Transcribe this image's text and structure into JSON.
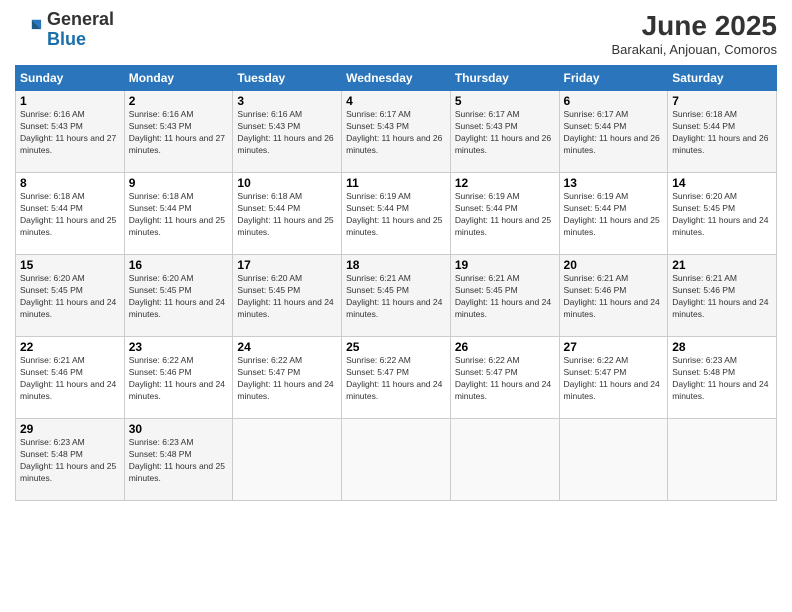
{
  "header": {
    "logo_general": "General",
    "logo_blue": "Blue",
    "title": "June 2025",
    "subtitle": "Barakani, Anjouan, Comoros"
  },
  "days_of_week": [
    "Sunday",
    "Monday",
    "Tuesday",
    "Wednesday",
    "Thursday",
    "Friday",
    "Saturday"
  ],
  "weeks": [
    [
      {
        "day": "1",
        "sunrise": "6:16 AM",
        "sunset": "5:43 PM",
        "daylight": "11 hours and 27 minutes."
      },
      {
        "day": "2",
        "sunrise": "6:16 AM",
        "sunset": "5:43 PM",
        "daylight": "11 hours and 27 minutes."
      },
      {
        "day": "3",
        "sunrise": "6:16 AM",
        "sunset": "5:43 PM",
        "daylight": "11 hours and 26 minutes."
      },
      {
        "day": "4",
        "sunrise": "6:17 AM",
        "sunset": "5:43 PM",
        "daylight": "11 hours and 26 minutes."
      },
      {
        "day": "5",
        "sunrise": "6:17 AM",
        "sunset": "5:43 PM",
        "daylight": "11 hours and 26 minutes."
      },
      {
        "day": "6",
        "sunrise": "6:17 AM",
        "sunset": "5:44 PM",
        "daylight": "11 hours and 26 minutes."
      },
      {
        "day": "7",
        "sunrise": "6:18 AM",
        "sunset": "5:44 PM",
        "daylight": "11 hours and 26 minutes."
      }
    ],
    [
      {
        "day": "8",
        "sunrise": "6:18 AM",
        "sunset": "5:44 PM",
        "daylight": "11 hours and 25 minutes."
      },
      {
        "day": "9",
        "sunrise": "6:18 AM",
        "sunset": "5:44 PM",
        "daylight": "11 hours and 25 minutes."
      },
      {
        "day": "10",
        "sunrise": "6:18 AM",
        "sunset": "5:44 PM",
        "daylight": "11 hours and 25 minutes."
      },
      {
        "day": "11",
        "sunrise": "6:19 AM",
        "sunset": "5:44 PM",
        "daylight": "11 hours and 25 minutes."
      },
      {
        "day": "12",
        "sunrise": "6:19 AM",
        "sunset": "5:44 PM",
        "daylight": "11 hours and 25 minutes."
      },
      {
        "day": "13",
        "sunrise": "6:19 AM",
        "sunset": "5:44 PM",
        "daylight": "11 hours and 25 minutes."
      },
      {
        "day": "14",
        "sunrise": "6:20 AM",
        "sunset": "5:45 PM",
        "daylight": "11 hours and 24 minutes."
      }
    ],
    [
      {
        "day": "15",
        "sunrise": "6:20 AM",
        "sunset": "5:45 PM",
        "daylight": "11 hours and 24 minutes."
      },
      {
        "day": "16",
        "sunrise": "6:20 AM",
        "sunset": "5:45 PM",
        "daylight": "11 hours and 24 minutes."
      },
      {
        "day": "17",
        "sunrise": "6:20 AM",
        "sunset": "5:45 PM",
        "daylight": "11 hours and 24 minutes."
      },
      {
        "day": "18",
        "sunrise": "6:21 AM",
        "sunset": "5:45 PM",
        "daylight": "11 hours and 24 minutes."
      },
      {
        "day": "19",
        "sunrise": "6:21 AM",
        "sunset": "5:45 PM",
        "daylight": "11 hours and 24 minutes."
      },
      {
        "day": "20",
        "sunrise": "6:21 AM",
        "sunset": "5:46 PM",
        "daylight": "11 hours and 24 minutes."
      },
      {
        "day": "21",
        "sunrise": "6:21 AM",
        "sunset": "5:46 PM",
        "daylight": "11 hours and 24 minutes."
      }
    ],
    [
      {
        "day": "22",
        "sunrise": "6:21 AM",
        "sunset": "5:46 PM",
        "daylight": "11 hours and 24 minutes."
      },
      {
        "day": "23",
        "sunrise": "6:22 AM",
        "sunset": "5:46 PM",
        "daylight": "11 hours and 24 minutes."
      },
      {
        "day": "24",
        "sunrise": "6:22 AM",
        "sunset": "5:47 PM",
        "daylight": "11 hours and 24 minutes."
      },
      {
        "day": "25",
        "sunrise": "6:22 AM",
        "sunset": "5:47 PM",
        "daylight": "11 hours and 24 minutes."
      },
      {
        "day": "26",
        "sunrise": "6:22 AM",
        "sunset": "5:47 PM",
        "daylight": "11 hours and 24 minutes."
      },
      {
        "day": "27",
        "sunrise": "6:22 AM",
        "sunset": "5:47 PM",
        "daylight": "11 hours and 24 minutes."
      },
      {
        "day": "28",
        "sunrise": "6:23 AM",
        "sunset": "5:48 PM",
        "daylight": "11 hours and 24 minutes."
      }
    ],
    [
      {
        "day": "29",
        "sunrise": "6:23 AM",
        "sunset": "5:48 PM",
        "daylight": "11 hours and 25 minutes."
      },
      {
        "day": "30",
        "sunrise": "6:23 AM",
        "sunset": "5:48 PM",
        "daylight": "11 hours and 25 minutes."
      },
      {
        "day": "",
        "sunrise": "",
        "sunset": "",
        "daylight": ""
      },
      {
        "day": "",
        "sunrise": "",
        "sunset": "",
        "daylight": ""
      },
      {
        "day": "",
        "sunrise": "",
        "sunset": "",
        "daylight": ""
      },
      {
        "day": "",
        "sunrise": "",
        "sunset": "",
        "daylight": ""
      },
      {
        "day": "",
        "sunrise": "",
        "sunset": "",
        "daylight": ""
      }
    ]
  ],
  "labels": {
    "sunrise_label": "Sunrise:",
    "sunset_label": "Sunset:",
    "daylight_label": "Daylight:"
  }
}
